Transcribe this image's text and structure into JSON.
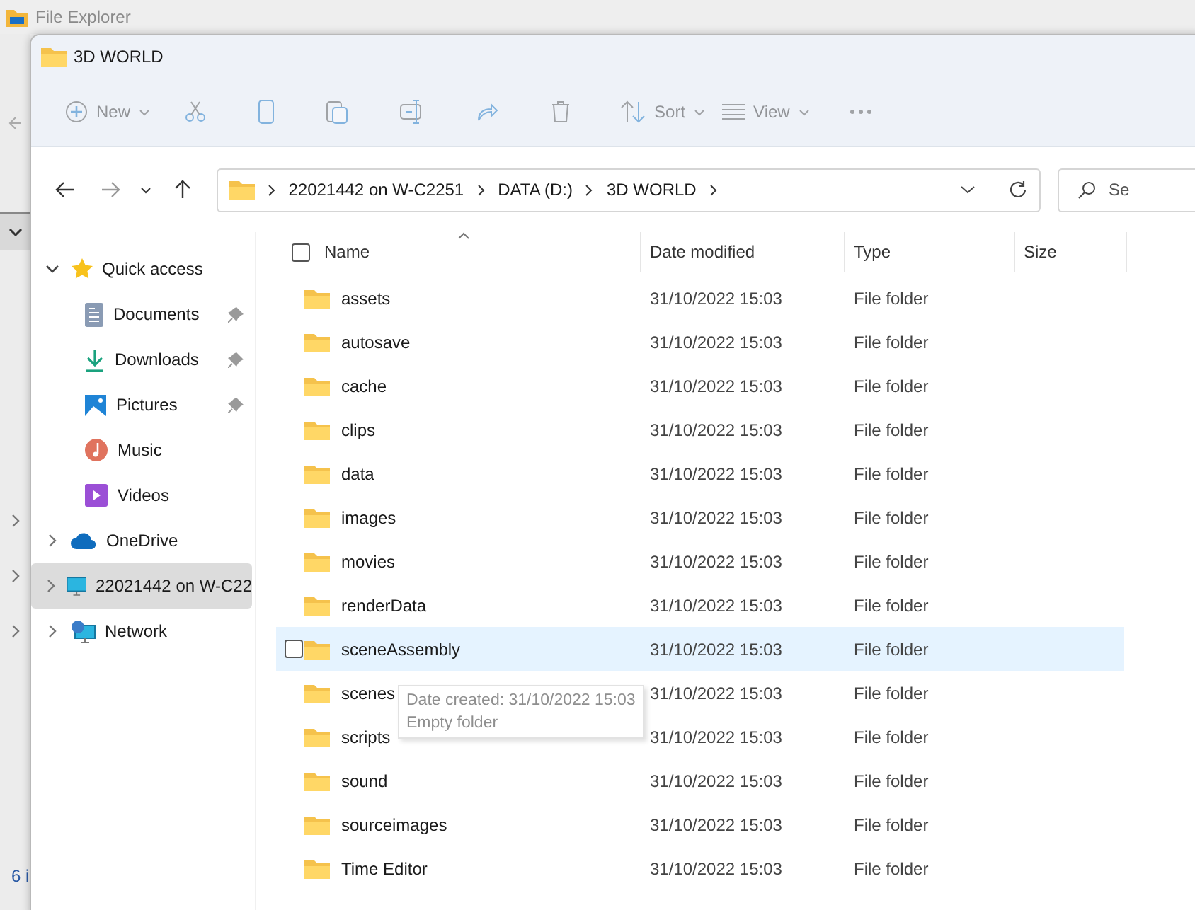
{
  "back_window": {
    "title": "File Explorer",
    "status_text": "6 i"
  },
  "window": {
    "title": "3D WORLD"
  },
  "toolbar": {
    "new_label": "New",
    "sort_label": "Sort",
    "view_label": "View",
    "disabled": true
  },
  "nav": {
    "back_disabled": false,
    "forward_disabled": true
  },
  "breadcrumbs": [
    "22021442 on W-C2251",
    "DATA (D:)",
    "3D WORLD"
  ],
  "search": {
    "placeholder": "Se"
  },
  "sidebar": {
    "items": [
      {
        "label": "Quick access",
        "expanded": true,
        "selected": false,
        "children": [
          {
            "label": "Documents",
            "pinned": true
          },
          {
            "label": "Downloads",
            "pinned": true
          },
          {
            "label": "Pictures",
            "pinned": true
          },
          {
            "label": "Music",
            "pinned": false
          },
          {
            "label": "Videos",
            "pinned": false
          }
        ]
      },
      {
        "label": "OneDrive",
        "expanded": false,
        "selected": false
      },
      {
        "label": "22021442 on W-C22",
        "expanded": false,
        "selected": true
      },
      {
        "label": "Network",
        "expanded": false,
        "selected": false
      }
    ]
  },
  "table": {
    "select_all_checked": false,
    "columns": [
      {
        "label": "Name",
        "sorted": true
      },
      {
        "label": "Date modified",
        "sorted": false
      },
      {
        "label": "Type",
        "sorted": false
      },
      {
        "label": "Size",
        "sorted": false
      }
    ],
    "rows": [
      {
        "name": "assets",
        "date": "31/10/2022 15:03",
        "type": "File folder",
        "hovered": false
      },
      {
        "name": "autosave",
        "date": "31/10/2022 15:03",
        "type": "File folder",
        "hovered": false
      },
      {
        "name": "cache",
        "date": "31/10/2022 15:03",
        "type": "File folder",
        "hovered": false
      },
      {
        "name": "clips",
        "date": "31/10/2022 15:03",
        "type": "File folder",
        "hovered": false
      },
      {
        "name": "data",
        "date": "31/10/2022 15:03",
        "type": "File folder",
        "hovered": false
      },
      {
        "name": "images",
        "date": "31/10/2022 15:03",
        "type": "File folder",
        "hovered": false
      },
      {
        "name": "movies",
        "date": "31/10/2022 15:03",
        "type": "File folder",
        "hovered": false
      },
      {
        "name": "renderData",
        "date": "31/10/2022 15:03",
        "type": "File folder",
        "hovered": false
      },
      {
        "name": "sceneAssembly",
        "date": "31/10/2022 15:03",
        "type": "File folder",
        "hovered": true
      },
      {
        "name": "scenes",
        "date": "31/10/2022 15:03",
        "type": "File folder",
        "hovered": false
      },
      {
        "name": "scripts",
        "date": "31/10/2022 15:03",
        "type": "File folder",
        "hovered": false
      },
      {
        "name": "sound",
        "date": "31/10/2022 15:03",
        "type": "File folder",
        "hovered": false
      },
      {
        "name": "sourceimages",
        "date": "31/10/2022 15:03",
        "type": "File folder",
        "hovered": false
      },
      {
        "name": "Time Editor",
        "date": "31/10/2022 15:03",
        "type": "File folder",
        "hovered": false
      }
    ]
  },
  "tooltip": {
    "lines": [
      "Date created: 31/10/2022 15:03",
      "Empty folder"
    ]
  }
}
